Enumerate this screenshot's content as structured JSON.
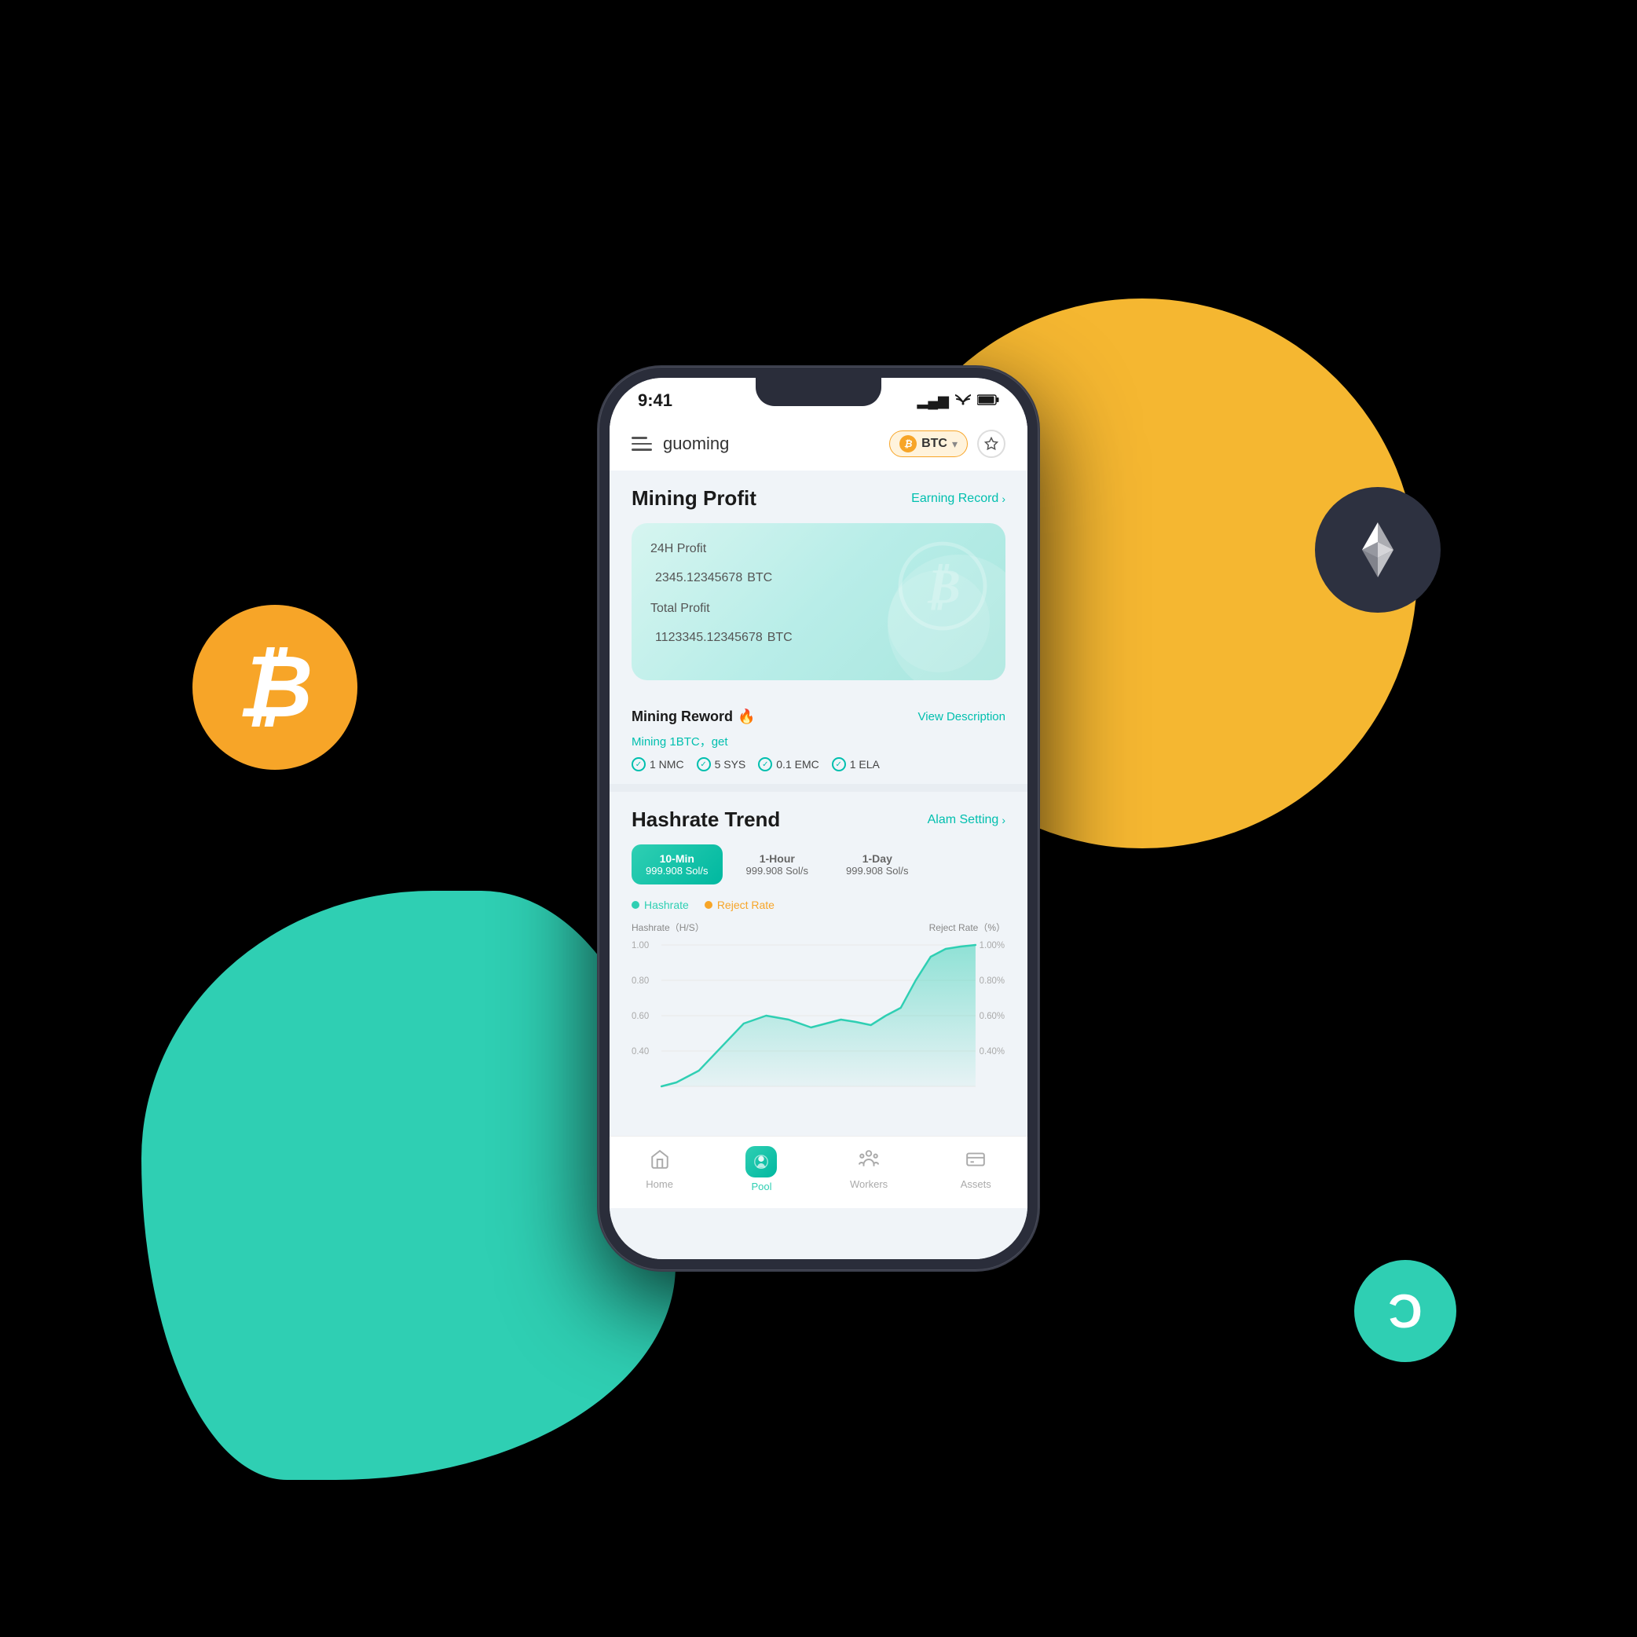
{
  "background": {
    "main_color": "#000000"
  },
  "status_bar": {
    "time": "9:41",
    "signal": "▂▄▆",
    "wifi": "wifi",
    "battery": "battery"
  },
  "top_nav": {
    "username": "guoming",
    "crypto_selector": "BTC",
    "crypto_arrow": "▾",
    "settings_icon": "⬡"
  },
  "mining_profit": {
    "title": "Mining Profit",
    "earning_record_link": "Earning Record",
    "profit_24h_label": "24H Profit",
    "profit_24h_value": "2345.12345678",
    "profit_24h_unit": "BTC",
    "total_profit_label": "Total Profit",
    "total_profit_value": "1123345.12345678",
    "total_profit_unit": "BTC"
  },
  "mining_reward": {
    "title": "Mining Reword",
    "fire_icon": "🔥",
    "view_description_link": "View Description",
    "subtitle": "Mining 1BTC，get",
    "items": [
      {
        "label": "1 NMC"
      },
      {
        "label": "5 SYS"
      },
      {
        "label": "0.1 EMC"
      },
      {
        "label": "1 ELA"
      }
    ]
  },
  "hashrate_trend": {
    "title": "Hashrate Trend",
    "alarm_link": "Alam Setting",
    "alarm_arrow": ">",
    "time_options": [
      {
        "id": "10min",
        "label": "10-Min",
        "value": "999.908 Sol/s",
        "active": true
      },
      {
        "id": "1hour",
        "label": "1-Hour",
        "value": "999.908 Sol/s",
        "active": false
      },
      {
        "id": "1day",
        "label": "1-Day",
        "value": "999.908 Sol/s",
        "active": false
      }
    ],
    "legend": {
      "hashrate_label": "Hashrate",
      "reject_rate_label": "Reject Rate"
    },
    "y_axis_left_title": "Hashrate（H/S）",
    "y_axis_right_title": "Reject Rate（%）",
    "y_labels_left": [
      "1.00",
      "0.80",
      "0.60",
      "0.40"
    ],
    "y_labels_right": [
      "1.00%",
      "0.80%",
      "0.60%",
      "0.40%"
    ]
  },
  "bottom_nav": {
    "items": [
      {
        "id": "home",
        "label": "Home",
        "icon": "⌂",
        "active": false
      },
      {
        "id": "pool",
        "label": "Pool",
        "icon": "pool",
        "active": true
      },
      {
        "id": "workers",
        "label": "Workers",
        "icon": "workers",
        "active": false
      },
      {
        "id": "assets",
        "label": "Assets",
        "icon": "assets",
        "active": false
      }
    ]
  }
}
